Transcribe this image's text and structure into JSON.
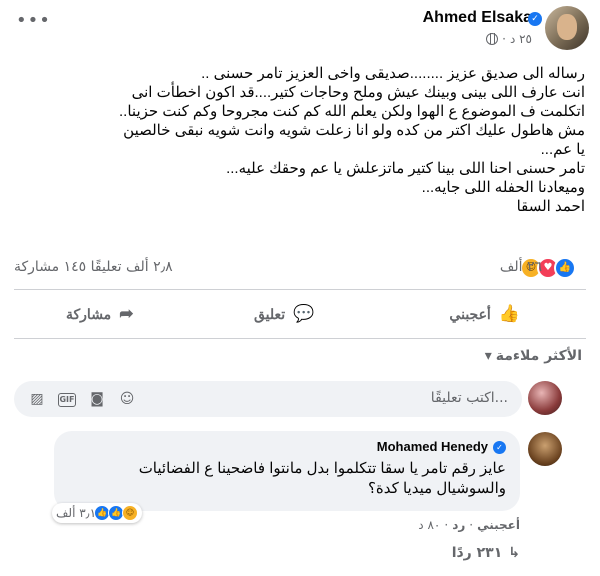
{
  "post": {
    "author": "Ahmed Elsaka",
    "time": "٢٥ د",
    "lines": [
      "رساله الى صديق عزيز ........صديقى واخى العزيز  تامر حسنى ..",
      "انت عارف اللى بينى وبينك   عيش وملح وحاجات كتير....قد اكون اخطأت انى",
      "اتكلمت ف الموضوع ع الهوا ولكن يعلم الله  كم كنت مجروحا وكم كنت حزينا..",
      "مش هاطول عليك اكتر من كده ولو انا زعلت شويه وانت شويه نبقى خالصين",
      "يا عم...",
      "تامر حسنى  احنا اللى بينا كتير  ماتزعلش يا عم وحقك عليه...",
      "وميعادنا الحفله اللى جايه...",
      "احمد السقا"
    ],
    "reaction_count": "٢٦ ألف",
    "stats": "٢٫٨ ألف تعليقًا ١٤٥ مشاركة",
    "reactions": [
      "like",
      "love",
      "care"
    ]
  },
  "actions": {
    "like": "أعجبني",
    "comment": "تعليق",
    "share": "مشاركة"
  },
  "sort_label": "الأكثر ملاءمة",
  "composer": {
    "placeholder": "اكتب تعليقًا..."
  },
  "comment": {
    "author": "Mohamed Henedy",
    "lines": [
      "عايز رقم تامر يا سقا تتكلموا بدل مانتوا فاضحينا ع الفضائيات",
      "والسوشيال ميديا كدة؟"
    ],
    "reaction_count": "٣٫١ ألف",
    "like": "أعجبني",
    "reply": "رد",
    "time": "٨٠ د",
    "replies": "٢٣١ ردًا"
  }
}
